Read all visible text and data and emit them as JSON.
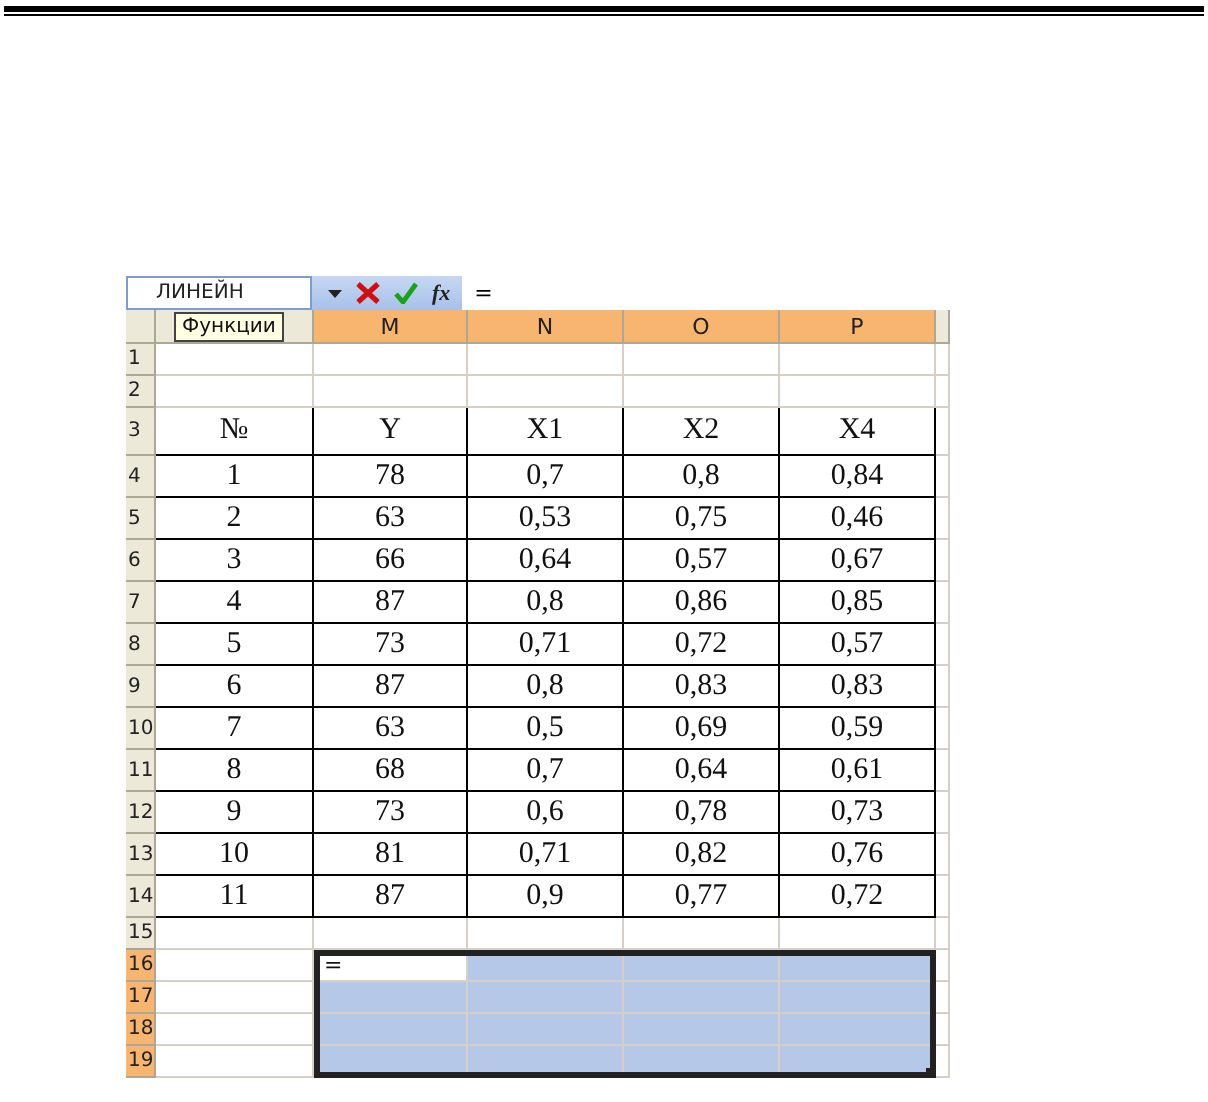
{
  "formula_bar": {
    "name_box": "ЛИНЕЙН",
    "function_label": "fx",
    "formula": "="
  },
  "tooltip": "Функции",
  "columns": [
    {
      "selected": false
    },
    {
      "label": "M",
      "selected": true
    },
    {
      "label": "N",
      "selected": true
    },
    {
      "label": "O",
      "selected": true
    },
    {
      "label": "P",
      "selected": true
    }
  ],
  "rows": [
    {
      "number": "1",
      "kind": "blank",
      "selected": false,
      "cells": [
        "",
        "",
        "",
        "",
        ""
      ]
    },
    {
      "number": "2",
      "kind": "blank",
      "selected": false,
      "cells": [
        "",
        "",
        "",
        "",
        ""
      ]
    },
    {
      "number": "3",
      "kind": "table",
      "selected": false,
      "cells": [
        "№",
        "Y",
        "X1",
        "X2",
        "X4"
      ]
    },
    {
      "number": "4",
      "kind": "table",
      "selected": false,
      "cells": [
        "1",
        "78",
        "0,7",
        "0,8",
        "0,84"
      ]
    },
    {
      "number": "5",
      "kind": "table",
      "selected": false,
      "cells": [
        "2",
        "63",
        "0,53",
        "0,75",
        "0,46"
      ]
    },
    {
      "number": "6",
      "kind": "table",
      "selected": false,
      "cells": [
        "3",
        "66",
        "0,64",
        "0,57",
        "0,67"
      ]
    },
    {
      "number": "7",
      "kind": "table",
      "selected": false,
      "cells": [
        "4",
        "87",
        "0,8",
        "0,86",
        "0,85"
      ]
    },
    {
      "number": "8",
      "kind": "table",
      "selected": false,
      "cells": [
        "5",
        "73",
        "0,71",
        "0,72",
        "0,57"
      ]
    },
    {
      "number": "9",
      "kind": "table",
      "selected": false,
      "cells": [
        "6",
        "87",
        "0,8",
        "0,83",
        "0,83"
      ]
    },
    {
      "number": "10",
      "kind": "table",
      "selected": false,
      "cells": [
        "7",
        "63",
        "0,5",
        "0,69",
        "0,59"
      ]
    },
    {
      "number": "11",
      "kind": "table",
      "selected": false,
      "cells": [
        "8",
        "68",
        "0,7",
        "0,64",
        "0,61"
      ]
    },
    {
      "number": "12",
      "kind": "table",
      "selected": false,
      "cells": [
        "9",
        "73",
        "0,6",
        "0,78",
        "0,73"
      ]
    },
    {
      "number": "13",
      "kind": "table",
      "selected": false,
      "cells": [
        "10",
        "81",
        "0,71",
        "0,82",
        "0,76"
      ]
    },
    {
      "number": "14",
      "kind": "table",
      "selected": false,
      "cells": [
        "11",
        "87",
        "0,9",
        "0,77",
        "0,72"
      ]
    },
    {
      "number": "15",
      "kind": "blank",
      "selected": false,
      "cells": [
        "",
        "",
        "",
        "",
        ""
      ]
    },
    {
      "number": "16",
      "kind": "blank",
      "selected": true,
      "cells": [
        "",
        {
          "text": "=",
          "active": true
        },
        "",
        "",
        ""
      ]
    },
    {
      "number": "17",
      "kind": "blank",
      "selected": true,
      "cells": [
        "",
        "",
        "",
        "",
        ""
      ]
    },
    {
      "number": "18",
      "kind": "blank",
      "selected": true,
      "cells": [
        "",
        "",
        "",
        "",
        ""
      ]
    },
    {
      "number": "19",
      "kind": "blank",
      "selected": true,
      "cells": [
        "",
        "",
        "",
        "",
        ""
      ]
    }
  ]
}
